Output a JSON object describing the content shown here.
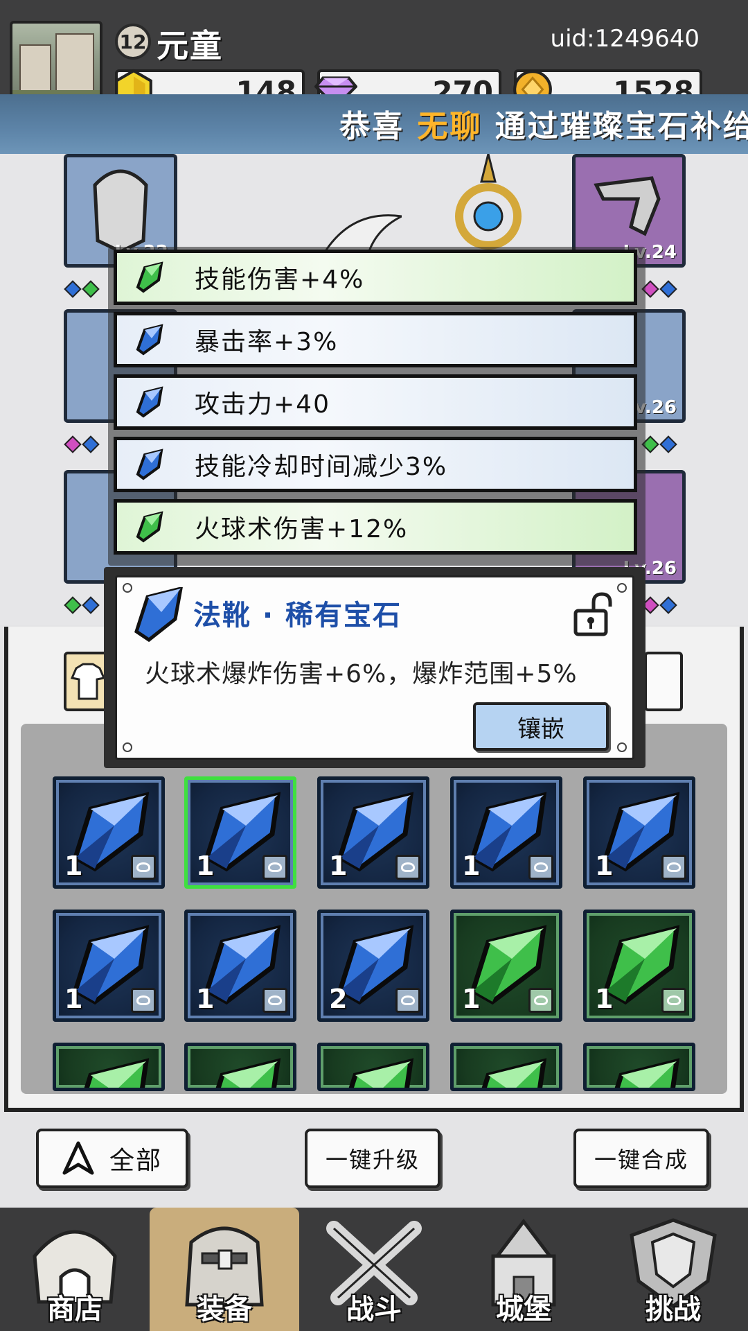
{
  "player": {
    "name": "元童",
    "level": "12",
    "uid": "uid:1249640"
  },
  "resources": {
    "energy": "148",
    "gems": "270",
    "gold": "1528"
  },
  "banner": {
    "prefix": "恭喜",
    "highlight": "无聊",
    "suffix": "通过璀璨宝石补给箱"
  },
  "equipment": {
    "slots": [
      {
        "name": "helmet",
        "level": "Lv.22",
        "rarity": "blue"
      },
      {
        "name": "gloves",
        "level": "Lv.24",
        "rarity": "purple"
      },
      {
        "name": "scarf",
        "level": "",
        "rarity": "blue"
      },
      {
        "name": "ring",
        "level": "Lv.26",
        "rarity": "blue"
      },
      {
        "name": "boots",
        "level": "",
        "rarity": "blue"
      },
      {
        "name": "necklace",
        "level": "Lv.26",
        "rarity": "purple"
      }
    ]
  },
  "stats": [
    {
      "label": "技能伤害+4%",
      "gem": "green"
    },
    {
      "label": "暴击率+3%",
      "gem": "blue"
    },
    {
      "label": "攻击力+40",
      "gem": "blue"
    },
    {
      "label": "技能冷却时间减少3%",
      "gem": "blue"
    },
    {
      "label": "火球术伤害+12%",
      "gem": "green"
    }
  ],
  "gem_detail": {
    "title": "法靴 · 稀有宝石",
    "description": "火球术爆炸伤害+6%，爆炸范围+5%",
    "inlay_button": "镶嵌",
    "locked": false
  },
  "inventory": {
    "rows": [
      [
        {
          "color": "blue",
          "count": "1",
          "tag": "boots",
          "selected": false
        },
        {
          "color": "blue",
          "count": "1",
          "tag": "boots",
          "selected": true
        },
        {
          "color": "blue",
          "count": "1",
          "tag": "boots",
          "selected": false
        },
        {
          "color": "blue",
          "count": "1",
          "tag": "ring",
          "selected": false
        },
        {
          "color": "blue",
          "count": "1",
          "tag": "ring",
          "selected": false
        }
      ],
      [
        {
          "color": "blue",
          "count": "1",
          "tag": "ring",
          "selected": false
        },
        {
          "color": "blue",
          "count": "1",
          "tag": "necklace",
          "selected": false
        },
        {
          "color": "blue",
          "count": "2",
          "tag": "necklace",
          "selected": false
        },
        {
          "color": "green",
          "count": "1",
          "tag": "necklace",
          "selected": false
        },
        {
          "color": "green",
          "count": "1",
          "tag": "necklace",
          "selected": false
        }
      ],
      [
        {
          "color": "green",
          "count": "",
          "tag": "",
          "selected": false
        },
        {
          "color": "green",
          "count": "",
          "tag": "",
          "selected": false
        },
        {
          "color": "green",
          "count": "",
          "tag": "",
          "selected": false
        },
        {
          "color": "green",
          "count": "",
          "tag": "",
          "selected": false
        },
        {
          "color": "green",
          "count": "",
          "tag": "",
          "selected": false
        }
      ]
    ]
  },
  "actions": {
    "filter": "全部",
    "upgrade_all": "一键升级",
    "merge_all": "一键合成"
  },
  "nav": [
    {
      "label": "商店",
      "icon": "shop-icon"
    },
    {
      "label": "装备",
      "icon": "backpack-icon"
    },
    {
      "label": "战斗",
      "icon": "swords-icon"
    },
    {
      "label": "城堡",
      "icon": "castle-icon"
    },
    {
      "label": "挑战",
      "icon": "shield-icon"
    }
  ],
  "colors": {
    "blue_gem": "#2f6fd6",
    "green_gem": "#3fbf4a",
    "banner_highlight": "#ffb52a",
    "selected_border": "#3fe03f",
    "nav_active": "#c9ad7c"
  }
}
